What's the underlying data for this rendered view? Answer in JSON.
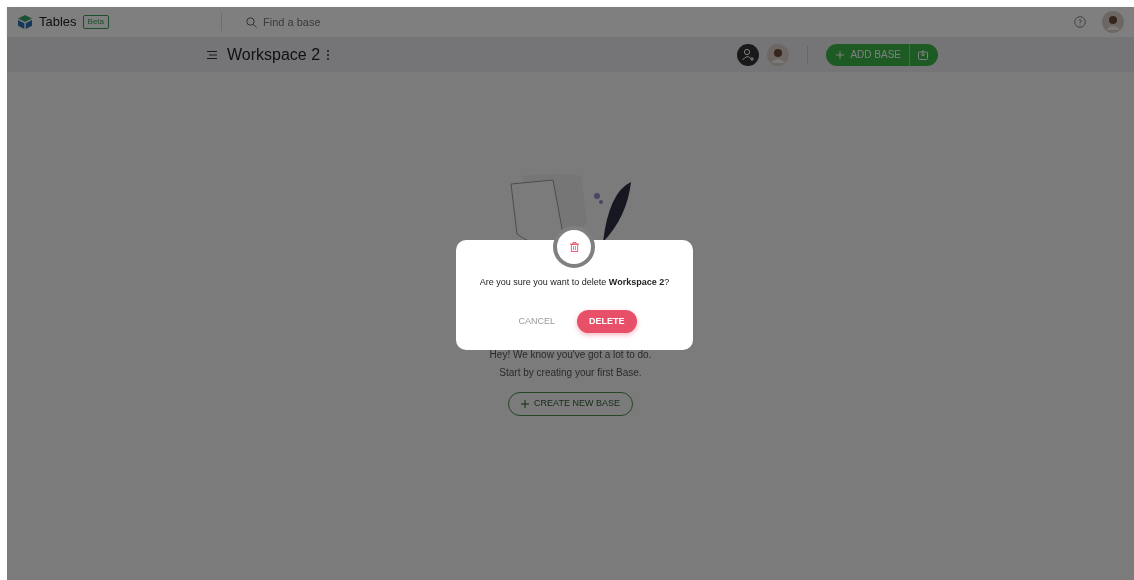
{
  "app": {
    "name": "Tables",
    "badge": "Beta"
  },
  "search": {
    "placeholder": "Find a base"
  },
  "workspace": {
    "title": "Workspace 2"
  },
  "add_base_button": {
    "label": "ADD BASE"
  },
  "empty_state": {
    "lines": [
      "Hey! We know you've got a lot to do.",
      "Start by creating your first Base."
    ],
    "button": "CREATE NEW BASE"
  },
  "dialog": {
    "message": "Are you sure you want to delete **Workspace 2**?",
    "cancel": "CANCEL",
    "delete": "DELETE"
  }
}
